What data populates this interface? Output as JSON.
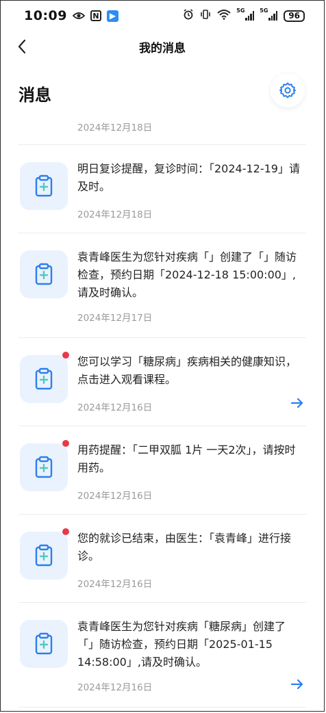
{
  "status_bar": {
    "time": "10:09",
    "battery": "96",
    "network_1": "5G",
    "network_2": "5G"
  },
  "header": {
    "title": "我的消息"
  },
  "section": {
    "title": "消息"
  },
  "top_date": "2024年12月18日",
  "messages": [
    {
      "text": "明日复诊提醒，复诊时间：「2024-12-19」请及时。",
      "date": "2024年12月18日",
      "unread": false,
      "has_arrow": false
    },
    {
      "text": "袁青峰医生为您针对疾病「」创建了「」随访检查，预约日期「2024-12-18 15:00:00」,请及时确认。",
      "date": "2024年12月17日",
      "unread": false,
      "has_arrow": false
    },
    {
      "text": "您可以学习「糖尿病」疾病相关的健康知识，点击进入观看课程。",
      "date": "2024年12月16日",
      "unread": true,
      "has_arrow": true
    },
    {
      "text": "用药提醒：「二甲双胍 1片 一天2次」，请按时用药。",
      "date": "2024年12月16日",
      "unread": true,
      "has_arrow": false
    },
    {
      "text": "您的就诊已结束，由医生：「袁青峰」进行接诊。",
      "date": "2024年12月16日",
      "unread": true,
      "has_arrow": false
    },
    {
      "text": "袁青峰医生为您针对疾病「糖尿病」创建了「」随访检查，预约日期「2025-01-15 14:58:00」,请及时确认。",
      "date": "2024年12月16日",
      "unread": false,
      "has_arrow": true
    }
  ],
  "colors": {
    "accent": "#2a7ff0",
    "unread_dot": "#e8394a",
    "icon_bg": "#eaf2fd"
  }
}
